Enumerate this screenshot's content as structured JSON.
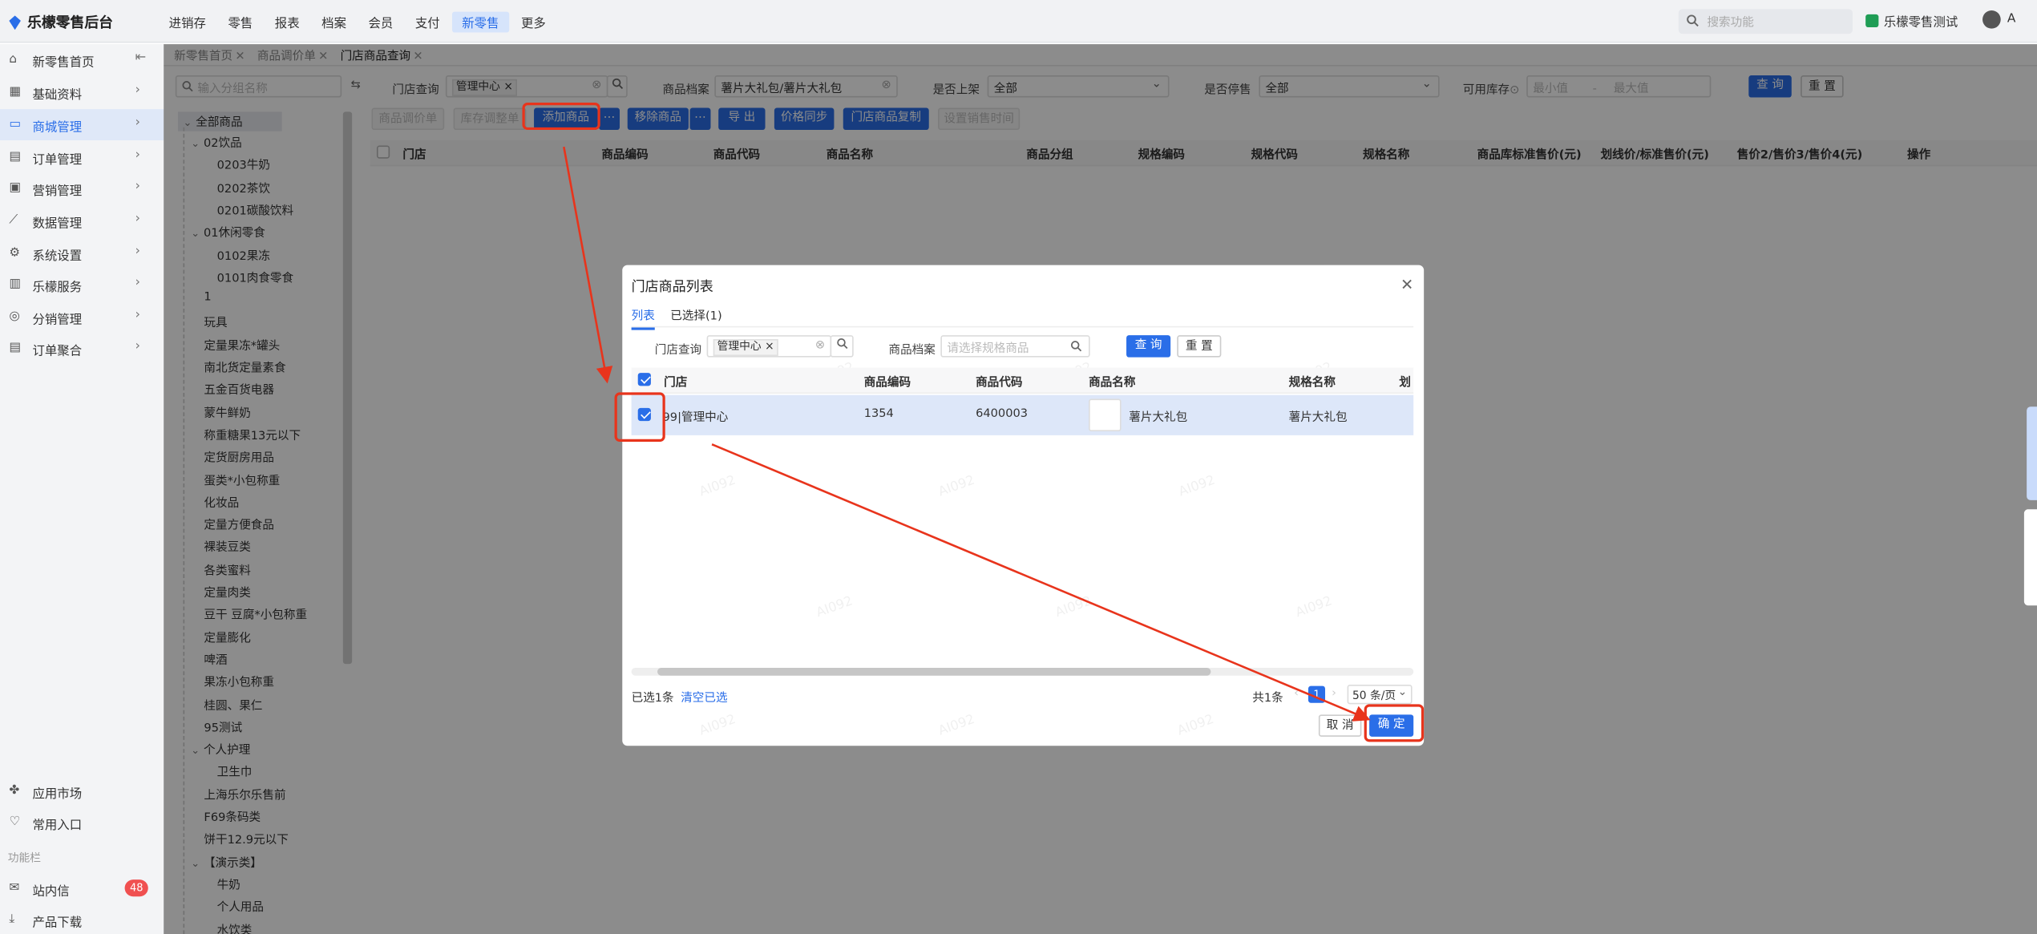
{
  "app": {
    "title": "乐檬零售后台"
  },
  "topnav": [
    "进销存",
    "零售",
    "报表",
    "档案",
    "会员",
    "支付",
    "新零售",
    "更多"
  ],
  "topnav_active": "新零售",
  "search": {
    "placeholder": "搜索功能"
  },
  "user": {
    "store": "乐檬零售测试",
    "initial": "A"
  },
  "sidebar": {
    "items": [
      {
        "label": "新零售首页",
        "icon": "home-icon",
        "arrow": "⇤"
      },
      {
        "label": "基础资料",
        "icon": "grid-icon",
        "arrow": "›"
      },
      {
        "label": "商城管理",
        "icon": "shop-icon",
        "arrow": "›"
      },
      {
        "label": "订单管理",
        "icon": "order-icon",
        "arrow": "›"
      },
      {
        "label": "营销管理",
        "icon": "gift-icon",
        "arrow": "›"
      },
      {
        "label": "数据管理",
        "icon": "chart-icon",
        "arrow": "›"
      },
      {
        "label": "系统设置",
        "icon": "gear-icon",
        "arrow": "›"
      },
      {
        "label": "乐檬服务",
        "icon": "briefcase-icon",
        "arrow": "›"
      },
      {
        "label": "分销管理",
        "icon": "share-icon",
        "arrow": "›"
      },
      {
        "label": "订单聚合",
        "icon": "doc-icon",
        "arrow": "›"
      }
    ],
    "bottom": [
      {
        "label": "应用市场",
        "icon": "apps-icon"
      },
      {
        "label": "常用入口",
        "icon": "heart-icon"
      }
    ],
    "section_label": "功能栏",
    "inbox": {
      "label": "站内信",
      "icon": "mail-icon",
      "badge": "48"
    },
    "download": {
      "label": "产品下载",
      "icon": "download-icon"
    }
  },
  "tabs": [
    "新零售首页",
    "商品调价单",
    "门店商品查询"
  ],
  "tree": {
    "search_placeholder": "输入分组名称",
    "root": "全部商品",
    "nodes": [
      {
        "label": "02饮品",
        "level": 1,
        "caret": true
      },
      {
        "label": "0203牛奶",
        "level": 2
      },
      {
        "label": "0202茶饮",
        "level": 2
      },
      {
        "label": "0201碳酸饮料",
        "level": 2
      },
      {
        "label": "01休闲零食",
        "level": 1,
        "caret": true
      },
      {
        "label": "0102果冻",
        "level": 2
      },
      {
        "label": "0101肉食零食",
        "level": 2
      },
      {
        "label": "1",
        "level": 1
      },
      {
        "label": "玩具",
        "level": 1
      },
      {
        "label": "定量果冻*罐头",
        "level": 1
      },
      {
        "label": "南北货定量素食",
        "level": 1
      },
      {
        "label": "五金百货电器",
        "level": 1
      },
      {
        "label": "蒙牛鲜奶",
        "level": 1
      },
      {
        "label": "称重糖果13元以下",
        "level": 1
      },
      {
        "label": "定货厨房用品",
        "level": 1
      },
      {
        "label": "蛋类*小包称重",
        "level": 1
      },
      {
        "label": "化妆品",
        "level": 1
      },
      {
        "label": "定量方便食品",
        "level": 1
      },
      {
        "label": "裸装豆类",
        "level": 1
      },
      {
        "label": "各类蜜料",
        "level": 1
      },
      {
        "label": "定量肉类",
        "level": 1
      },
      {
        "label": "豆干 豆腐*小包称重",
        "level": 1
      },
      {
        "label": "定量膨化",
        "level": 1
      },
      {
        "label": "啤酒",
        "level": 1
      },
      {
        "label": "果冻小包称重",
        "level": 1
      },
      {
        "label": "桂圆、果仁",
        "level": 1
      },
      {
        "label": "95测试",
        "level": 1
      },
      {
        "label": "个人护理",
        "level": 1,
        "caret": true
      },
      {
        "label": "卫生巾",
        "level": 2
      },
      {
        "label": "上海乐尔乐售前",
        "level": 1
      },
      {
        "label": "F69条码类",
        "level": 1
      },
      {
        "label": "饼干12.9元以下",
        "level": 1
      },
      {
        "label": "【演示类】",
        "level": 1,
        "caret": true
      },
      {
        "label": "牛奶",
        "level": 2
      },
      {
        "label": "个人用品",
        "level": 2
      },
      {
        "label": "水饮类",
        "level": 2
      }
    ]
  },
  "filters": {
    "store_label": "门店查询",
    "store_tag": "管理中心",
    "archive_label": "商品档案",
    "archive_value": "薯片大礼包/薯片大礼包",
    "onshelf_label": "是否上架",
    "onshelf_value": "全部",
    "stop_label": "是否停售",
    "stop_value": "全部",
    "stock_label": "可用库存",
    "stock_min": "最小值",
    "stock_max": "最大值",
    "query": "查 询",
    "reset": "重 置"
  },
  "toolbar": {
    "price_adjust": "商品调价单",
    "stock_adjust": "库存调整单",
    "add": "添加商品",
    "more1": "⋯",
    "remove": "移除商品",
    "more2": "⋯",
    "export": "导 出",
    "price_sync": "价格同步",
    "copy": "门店商品复制",
    "sale_time": "设置销售时间"
  },
  "table_headers": [
    "门店",
    "商品编码",
    "商品代码",
    "商品名称",
    "商品分组",
    "规格编码",
    "规格代码",
    "规格名称",
    "商品库标准售价(元)",
    "划线价/标准售价(元)",
    "售价2/售价3/售价4(元)",
    "操作"
  ],
  "modal": {
    "title": "门店商品列表",
    "tabs": [
      "列表",
      "已选择(1)"
    ],
    "store_label": "门店查询",
    "store_tag": "管理中心",
    "archive_label": "商品档案",
    "archive_placeholder": "请选择规格商品",
    "query": "查 询",
    "reset": "重 置",
    "headers": [
      "门店",
      "商品编码",
      "商品代码",
      "商品名称",
      "规格名称",
      "划"
    ],
    "rows": [
      {
        "store": "99|管理中心",
        "code": "1354",
        "product_code": "6400003",
        "name": "薯片大礼包",
        "spec": "薯片大礼包",
        "checked": true
      }
    ],
    "selected_text": "已选1条",
    "clear_text": "清空已选",
    "total": "共1条",
    "page": "1",
    "page_size": "50 条/页",
    "cancel": "取 消",
    "confirm": "确 定"
  },
  "watermark": "AI092",
  "colors": {
    "accent": "#2a6ee8",
    "annotation": "#e8341c"
  }
}
